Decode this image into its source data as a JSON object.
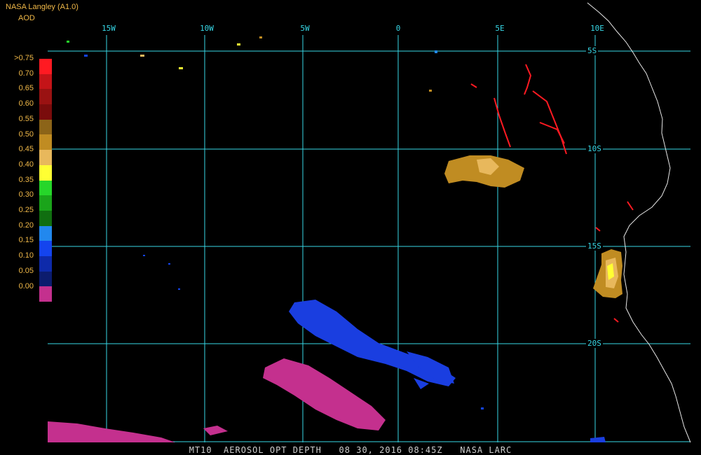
{
  "header": {
    "title": "NASA Langley (A1.0)",
    "subtitle": "AOD"
  },
  "colorbar": {
    "labels": [
      ">0.75",
      "0.70",
      "0.65",
      "0.60",
      "0.55",
      "0.50",
      "0.45",
      "0.40",
      "0.35",
      "0.30",
      "0.25",
      "0.20",
      "0.15",
      "0.10",
      "0.05",
      "0.00"
    ],
    "colors": [
      "#ff1a22",
      "#c41418",
      "#9a1212",
      "#7a0c0c",
      "#8c6418",
      "#c08c22",
      "#e8b85c",
      "#ffff33",
      "#26d62a",
      "#1aa41a",
      "#106e10",
      "#2288ee",
      "#1444ee",
      "#0e2aaa",
      "#0c1c6e",
      "#c4308e"
    ]
  },
  "grid": {
    "lon_labels": [
      "15W",
      "10W",
      "5W",
      "0",
      "5E",
      "10E"
    ],
    "lat_labels": [
      "5S",
      "10S",
      "15S",
      "20S"
    ],
    "color": "#37d7e6"
  },
  "footer": {
    "text": "MT10  AEROSOL OPT DEPTH   08 30, 2016 08:45Z   NASA LARC"
  }
}
